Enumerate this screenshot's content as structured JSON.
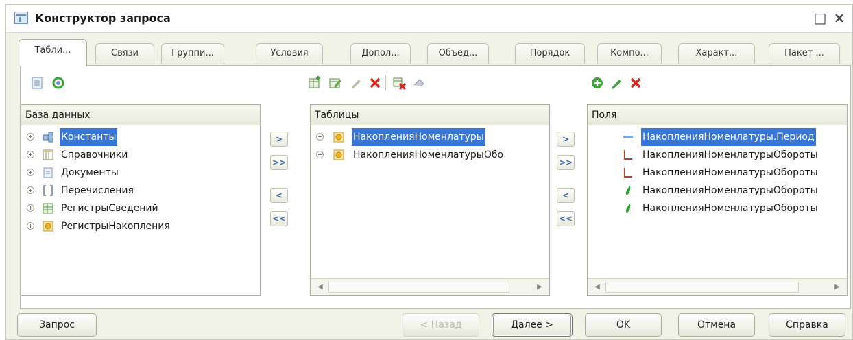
{
  "window": {
    "title": "Конструктор запроса",
    "maximize_glyph": "□",
    "close_glyph": "×"
  },
  "tabs": [
    {
      "label": "Табли..."
    },
    {
      "label": "Связи"
    },
    {
      "label": "Группи..."
    },
    {
      "label": "Условия"
    },
    {
      "label": "Допол..."
    },
    {
      "label": "Объед..."
    },
    {
      "label": "Порядок"
    },
    {
      "label": "Компо..."
    },
    {
      "label": "Характ..."
    },
    {
      "label": "Пакет ..."
    }
  ],
  "database": {
    "header": "База данных",
    "items": [
      {
        "label": "Константы",
        "icon": "constants-icon",
        "selected": true
      },
      {
        "label": "Справочники",
        "icon": "catalogs-icon"
      },
      {
        "label": "Документы",
        "icon": "documents-icon"
      },
      {
        "label": "Перечисления",
        "icon": "enums-icon"
      },
      {
        "label": "РегистрыСведений",
        "icon": "info-registers-icon"
      },
      {
        "label": "РегистрыНакопления",
        "icon": "accumulation-registers-icon"
      }
    ]
  },
  "tables": {
    "header": "Таблицы",
    "items": [
      {
        "label": "НакопленияНоменлатуры",
        "selected": true
      },
      {
        "label": "НакопленияНоменлатурыОбо"
      }
    ]
  },
  "fields": {
    "header": "Поля",
    "items": [
      {
        "label": "НакопленияНоменлатуры.Период",
        "icon": "dimension-icon",
        "selected": true
      },
      {
        "label": "НакопленияНоменлатурыОбороты",
        "icon": "attribute-icon"
      },
      {
        "label": "НакопленияНоменлатурыОбороты",
        "icon": "attribute-icon"
      },
      {
        "label": "НакопленияНоменлатурыОбороты",
        "icon": "resource-icon"
      },
      {
        "label": "НакопленияНоменлатурыОбороты",
        "icon": "resource-icon"
      }
    ]
  },
  "move_buttons": {
    "add": ">",
    "add_all": ">>",
    "remove": "<",
    "remove_all": "<<"
  },
  "footer": {
    "query": "Запрос",
    "back": "< Назад",
    "next": "Далее >",
    "ok": "OK",
    "cancel": "Отмена",
    "help": "Справка"
  },
  "colors": {
    "selection": "#3875d7",
    "background": "#f1f3e6",
    "accent_red": "#d9261c",
    "accent_green": "#3aa33a"
  }
}
